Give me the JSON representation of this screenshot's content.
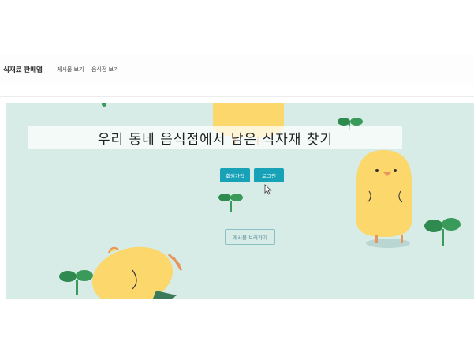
{
  "navbar": {
    "brand": "식재료 판매앱",
    "links": [
      "게시물 보기",
      "음식점 보기"
    ]
  },
  "hero": {
    "title": "우리 동네 음식점에서 남은 식자재 찾기",
    "signup_button": "회원가입",
    "login_button": "로그인",
    "board_button": "게시물 보러가기"
  },
  "colors": {
    "hero_background": "#d7ebe7",
    "button_primary": "#17a2b8",
    "chick": "#fbd76c",
    "sprout": "#3a9a5a"
  },
  "icons": [
    "chick-illustration",
    "sprout-icon",
    "cursor-icon"
  ]
}
